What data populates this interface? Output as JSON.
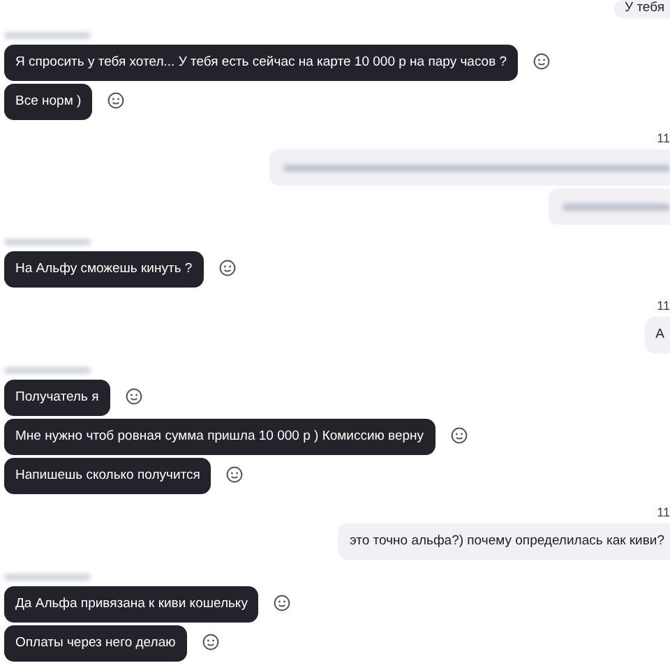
{
  "messages": [
    {
      "kind": "outgoing",
      "text": "У тебя"
    },
    {
      "kind": "sender",
      "redacted": true
    },
    {
      "kind": "incoming",
      "text": "Я спросить у тебя хотел... У тебя есть сейчас на карте 10 000 р на пару часов ?"
    },
    {
      "kind": "incoming",
      "text": "Все норм )"
    },
    {
      "kind": "time",
      "text": "11"
    },
    {
      "kind": "outgoing",
      "redacted": true
    },
    {
      "kind": "outgoing",
      "redacted": true
    },
    {
      "kind": "sender",
      "redacted": true
    },
    {
      "kind": "incoming",
      "text": "На Альфу сможешь кинуть ?"
    },
    {
      "kind": "time",
      "text": "11"
    },
    {
      "kind": "outgoing",
      "text": "А"
    },
    {
      "kind": "sender",
      "redacted": true
    },
    {
      "kind": "incoming",
      "text": "Получатель я"
    },
    {
      "kind": "incoming",
      "text": "Мне нужно чтоб ровная сумма пришла 10 000 р ) Комиссию верну"
    },
    {
      "kind": "incoming",
      "text": "Напишешь сколько получится"
    },
    {
      "kind": "time",
      "text": "11"
    },
    {
      "kind": "outgoing",
      "text": "это точно альфа?) почему определилась как киви?"
    },
    {
      "kind": "sender",
      "redacted": true
    },
    {
      "kind": "incoming",
      "text": "Да Альфа привязана к киви кошельку"
    },
    {
      "kind": "incoming",
      "text": "Оплаты через него делаю"
    }
  ]
}
